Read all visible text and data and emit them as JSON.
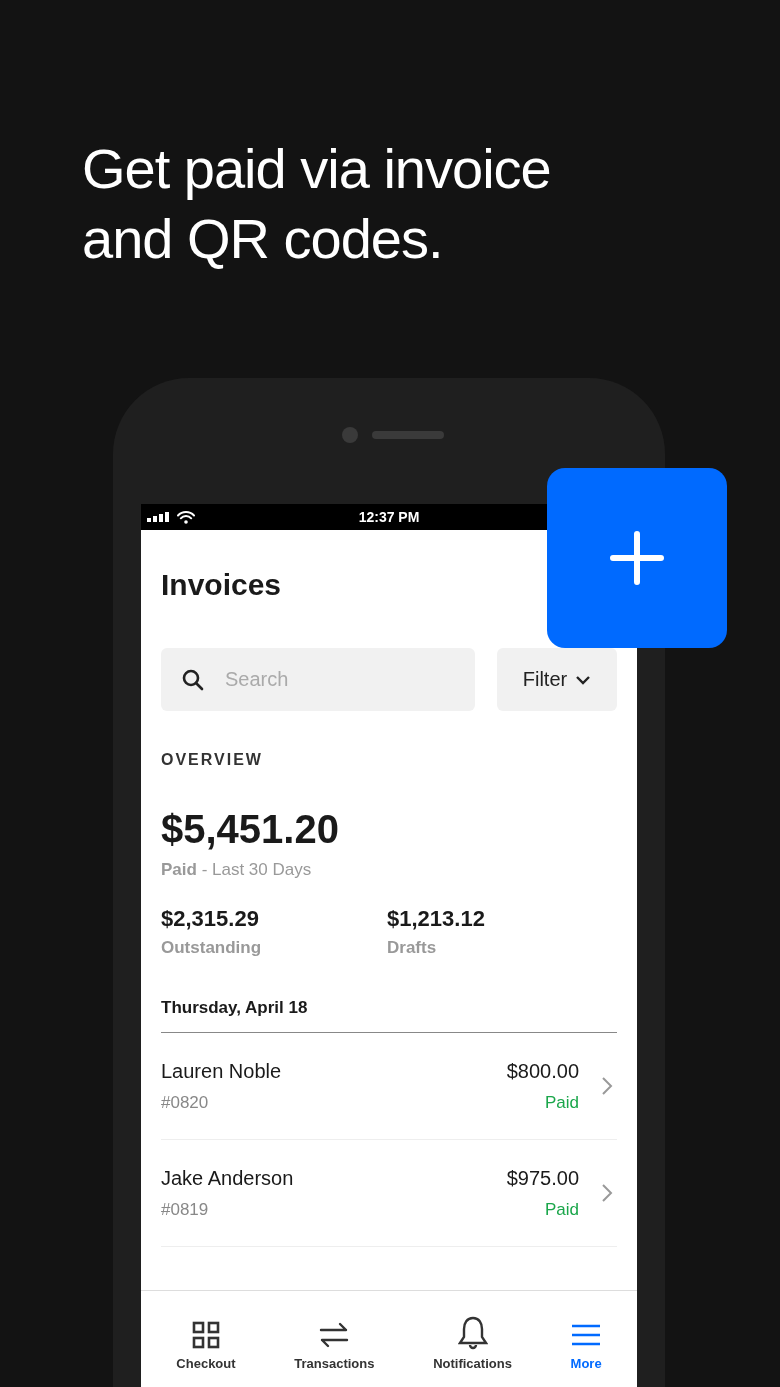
{
  "headline": "Get paid via invoice and QR codes.",
  "status_bar": {
    "time": "12:37 PM"
  },
  "title": "Invoices",
  "search": {
    "placeholder": "Search"
  },
  "filter": {
    "label": "Filter"
  },
  "overview": {
    "heading": "OVERVIEW",
    "total": "$5,451.20",
    "caption": "**Paid** - Last 30 Days",
    "stats": [
      {
        "amount": "$2,315.29",
        "label": "Outstanding"
      },
      {
        "amount": "$1,213.12",
        "label": "Drafts"
      }
    ]
  },
  "date_heading": "Thursday, April 18",
  "invoices": [
    {
      "name": "Lauren Noble",
      "number": "#0820",
      "amount": "$800.00",
      "status": "Paid",
      "color": "#1aa64a"
    },
    {
      "name": "Jake Anderson",
      "number": "#0819",
      "amount": "$975.00",
      "status": "Paid",
      "color": "#1aa64a"
    }
  ],
  "tabs": [
    {
      "label": "Checkout",
      "kind": "grid",
      "selected": false
    },
    {
      "label": "Transactions",
      "kind": "swap",
      "selected": false
    },
    {
      "label": "Notifications",
      "kind": "bell",
      "selected": false
    },
    {
      "label": "More",
      "kind": "menu",
      "selected": true
    }
  ]
}
